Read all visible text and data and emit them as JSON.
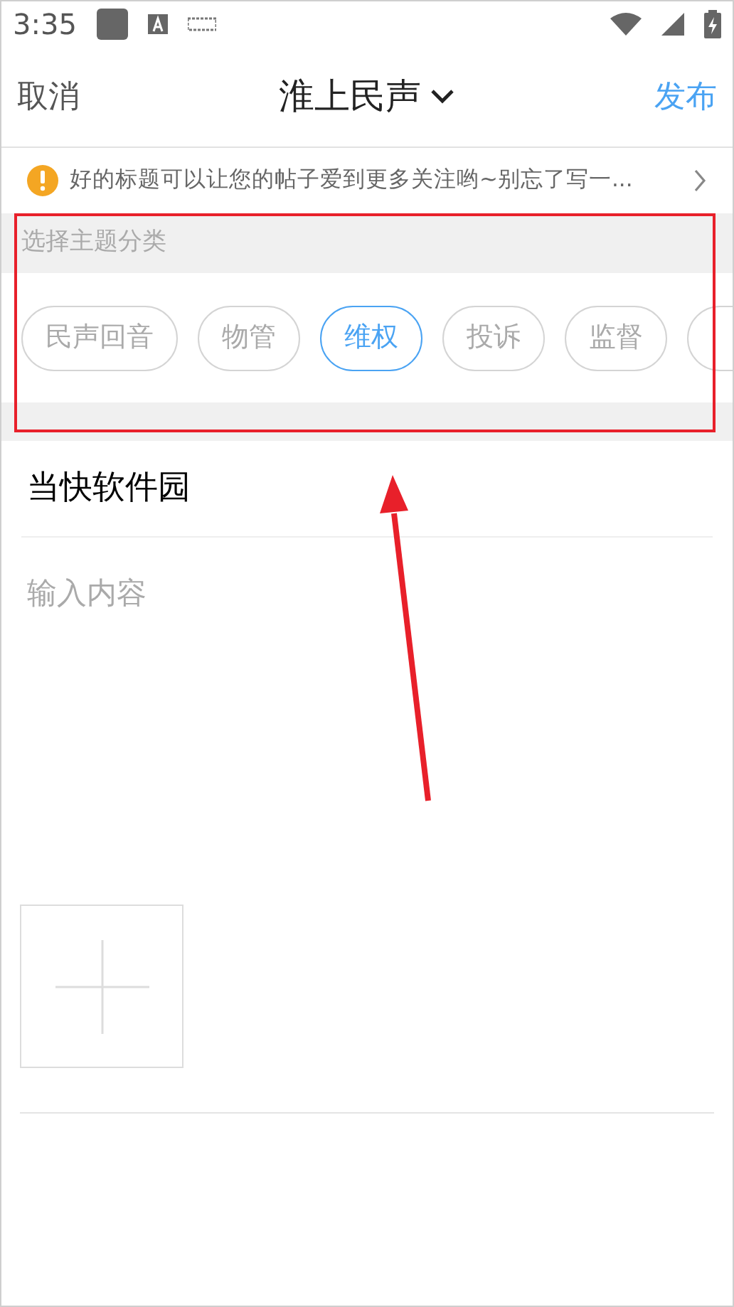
{
  "status_bar": {
    "time": "3:35"
  },
  "nav": {
    "cancel": "取消",
    "title": "淮上民声",
    "publish": "发布"
  },
  "tip": {
    "text": "好的标题可以让您的帖子爱到更多关注哟~别忘了写一..."
  },
  "category": {
    "heading": "选择主题分类",
    "chips": [
      {
        "label": "民声回音",
        "selected": false
      },
      {
        "label": "物管",
        "selected": false
      },
      {
        "label": "维权",
        "selected": true
      },
      {
        "label": "投诉",
        "selected": false
      },
      {
        "label": "监督",
        "selected": false
      }
    ]
  },
  "post": {
    "title": "当快软件园",
    "content_placeholder": "输入内容"
  }
}
